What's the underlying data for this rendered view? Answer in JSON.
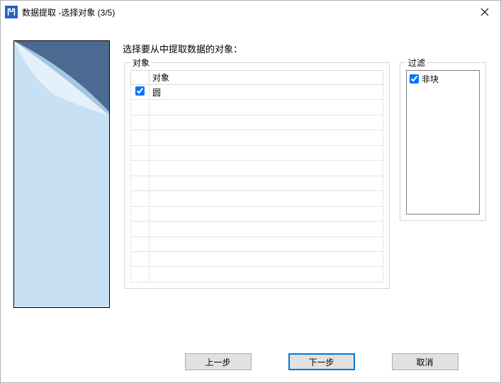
{
  "window": {
    "title": "数据提取 -选择对象 (3/5)"
  },
  "instruction": "选择要从中提取数据的对象：",
  "groups": {
    "objects_label": "对象",
    "filter_label": "过滤"
  },
  "object_table": {
    "header": "对象",
    "rows": [
      {
        "checked": true,
        "name": "圆"
      }
    ],
    "blank_rows": 12
  },
  "filter": {
    "items": [
      {
        "checked": true,
        "label": "非块"
      }
    ]
  },
  "buttons": {
    "back": "上一步",
    "next": "下一步",
    "cancel": "取消"
  }
}
